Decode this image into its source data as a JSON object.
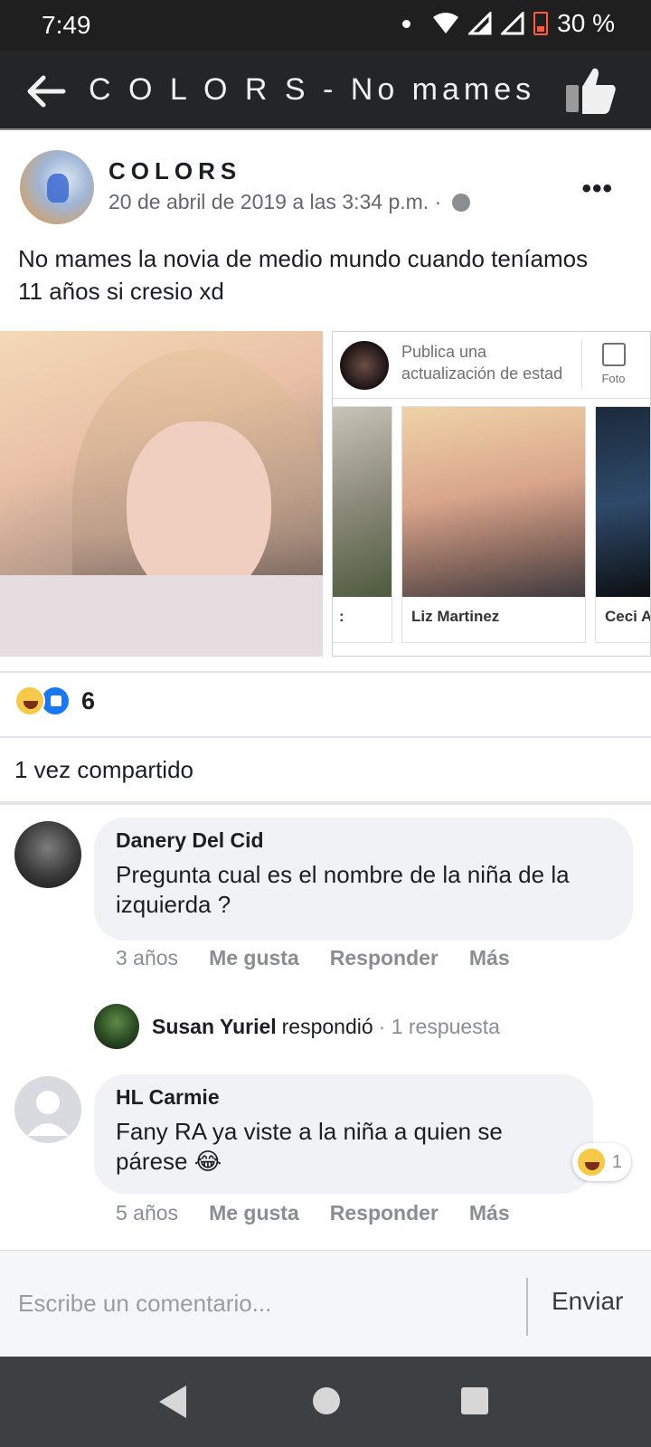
{
  "status_bar": {
    "time": "7:49",
    "battery": "30 %"
  },
  "app_bar": {
    "title": "C O L O R S - No mames la..."
  },
  "post": {
    "page_name": "COLORS",
    "timestamp": "20 de abril de 2019 a las 3:34 p.m. ·",
    "text": "No mames la novia de medio mundo cuando teníamos 11 años si cresio xd",
    "image_right": {
      "composer_text": "Publica una actualización de estad",
      "photo_label": "Foto",
      "story_names": [
        ":",
        "Liz Martinez",
        "Ceci A"
      ]
    },
    "reaction_count": "6",
    "shares": "1 vez compartido"
  },
  "comments": [
    {
      "author": "Danery Del Cid",
      "text": "Pregunta cual es el nombre de la niña de la izquierda ?",
      "time": "3 años",
      "like": "Me gusta",
      "reply": "Responder",
      "more": "Más"
    },
    {
      "author": "HL Carmie",
      "text": "Fany RA ya viste a la niña a quien se párese 😂",
      "time": "5 años",
      "like": "Me gusta",
      "reply": "Responder",
      "more": "Más",
      "reaction_count": "1"
    }
  ],
  "reply_summary": {
    "name": "Susan Yuriel",
    "verb": "respondió",
    "count": "· 1 respuesta"
  },
  "composer": {
    "placeholder": "Escribe un comentario...",
    "send": "Enviar"
  },
  "colors": {
    "facebook_blue": "#1877f2",
    "haha_yellow": "#f7c948",
    "bubble_gray": "#f0f2f5"
  },
  "icons": [
    "back-arrow-icon",
    "thumbs-up-icon",
    "more-options-icon",
    "globe-icon",
    "haha-reaction-icon",
    "like-reaction-icon",
    "nav-back-icon",
    "nav-home-icon",
    "nav-recents-icon"
  ]
}
